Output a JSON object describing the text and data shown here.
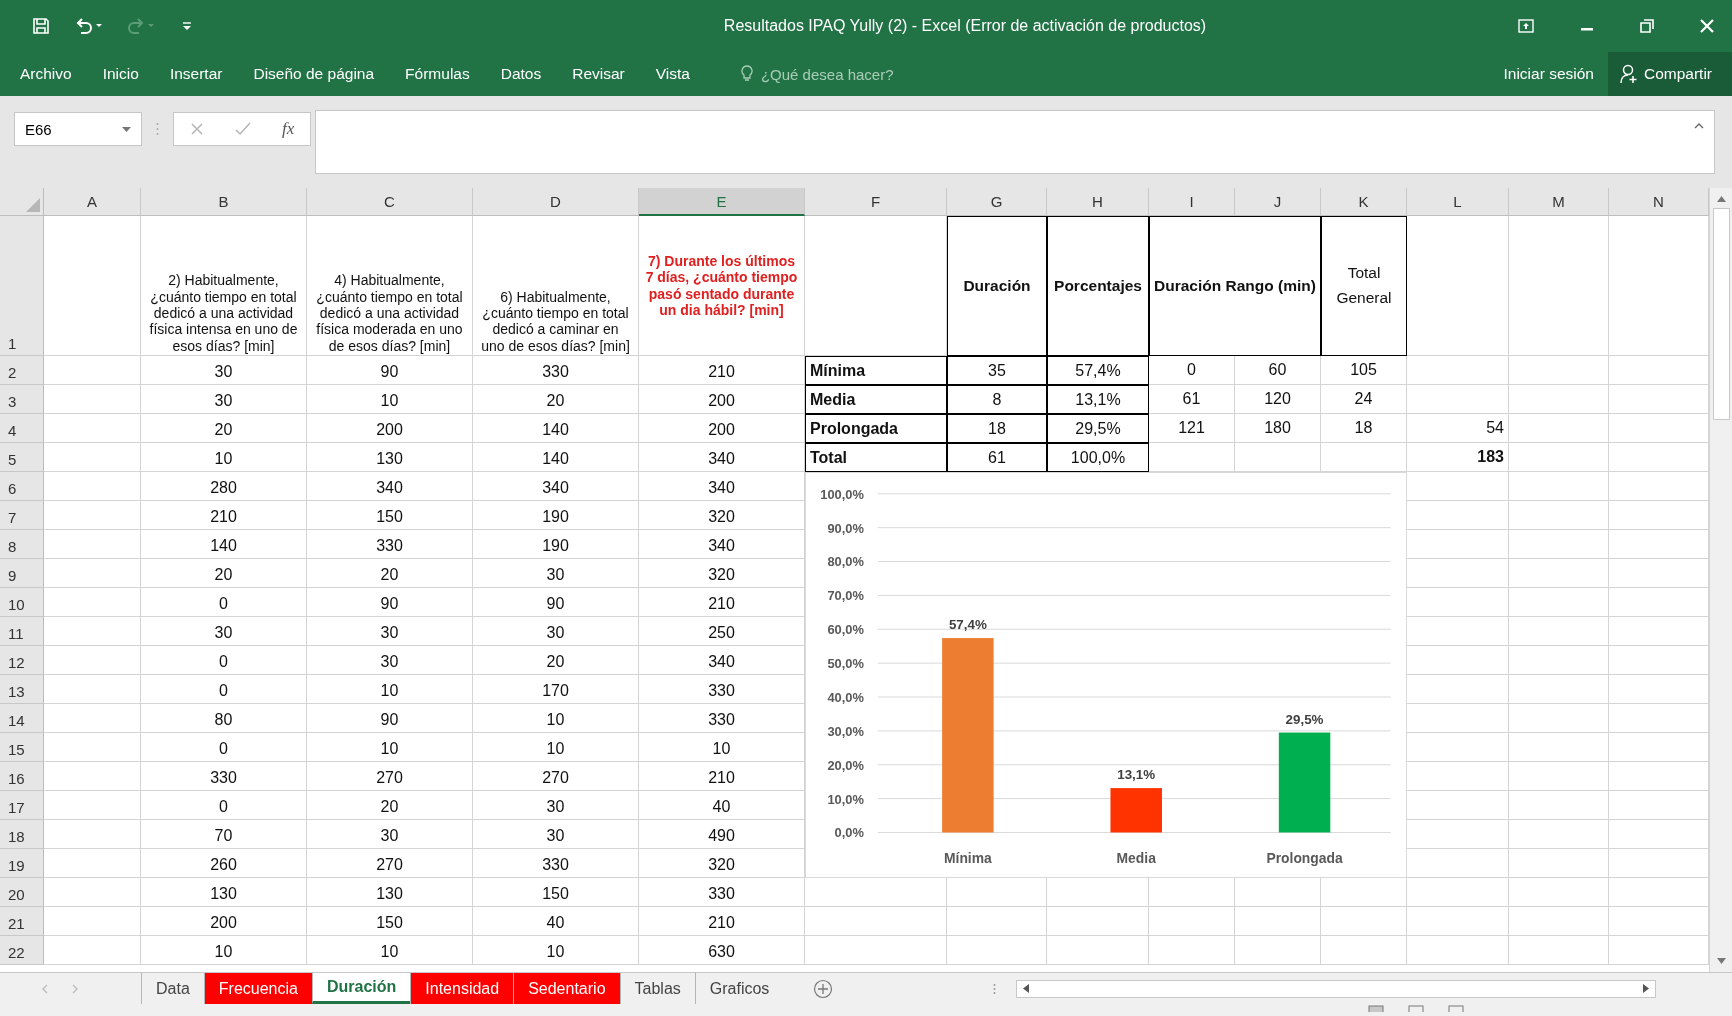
{
  "window": {
    "title": "Resultados IPAQ Yully (2) - Excel (Error de activación de productos)"
  },
  "ribbon_tabs": [
    "Archivo",
    "Inicio",
    "Insertar",
    "Diseño de página",
    "Fórmulas",
    "Datos",
    "Revisar",
    "Vista"
  ],
  "tell_me": {
    "placeholder": "¿Qué desea hacer?"
  },
  "sign_in": "Iniciar sesión",
  "share": "Compartir",
  "formula_bar": {
    "name_box": "E66",
    "insert_function": "fx"
  },
  "column_headers": [
    {
      "label": "A",
      "selected": false
    },
    {
      "label": "B",
      "selected": false
    },
    {
      "label": "C",
      "selected": false
    },
    {
      "label": "D",
      "selected": false
    },
    {
      "label": "E",
      "selected": true
    },
    {
      "label": "F",
      "selected": false
    },
    {
      "label": "G",
      "selected": false
    },
    {
      "label": "H",
      "selected": false
    },
    {
      "label": "I",
      "selected": false
    },
    {
      "label": "J",
      "selected": false
    },
    {
      "label": "K",
      "selected": false
    },
    {
      "label": "L",
      "selected": false
    },
    {
      "label": "M",
      "selected": false
    },
    {
      "label": "N",
      "selected": false
    }
  ],
  "row_numbers": [
    "1",
    "2",
    "3",
    "4",
    "5",
    "6",
    "7",
    "8",
    "9",
    "10",
    "11",
    "12",
    "13",
    "14",
    "15",
    "16",
    "17",
    "18",
    "19",
    "20",
    "21",
    "22"
  ],
  "survey_table": {
    "headers": [
      {
        "text": "2) Habitualmente, ¿cuánto tiempo en total dedicó a una actividad física intensa en uno de esos días? [min]",
        "emphasized": false
      },
      {
        "text": "4) Habitualmente, ¿cuánto tiempo en total dedicó a una actividad física moderada en uno de esos días? [min]",
        "emphasized": false
      },
      {
        "text": "6) Habitualmente, ¿cuánto tiempo en total dedicó a caminar en uno de esos días? [min]",
        "emphasized": false
      },
      {
        "text": "7) Durante los últimos 7 días, ¿cuánto tiempo pasó sentado durante un dia hábil? [min]",
        "emphasized": true
      }
    ],
    "rows": [
      [
        "30",
        "90",
        "330",
        "210"
      ],
      [
        "30",
        "10",
        "20",
        "200"
      ],
      [
        "20",
        "200",
        "140",
        "200"
      ],
      [
        "10",
        "130",
        "140",
        "340"
      ],
      [
        "280",
        "340",
        "340",
        "340"
      ],
      [
        "210",
        "150",
        "190",
        "320"
      ],
      [
        "140",
        "330",
        "190",
        "340"
      ],
      [
        "20",
        "20",
        "30",
        "320"
      ],
      [
        "0",
        "90",
        "90",
        "210"
      ],
      [
        "30",
        "30",
        "30",
        "250"
      ],
      [
        "0",
        "30",
        "20",
        "340"
      ],
      [
        "0",
        "10",
        "170",
        "330"
      ],
      [
        "80",
        "90",
        "10",
        "330"
      ],
      [
        "0",
        "10",
        "10",
        "10"
      ],
      [
        "330",
        "270",
        "270",
        "210"
      ],
      [
        "0",
        "20",
        "30",
        "40"
      ],
      [
        "70",
        "30",
        "30",
        "490"
      ],
      [
        "260",
        "270",
        "330",
        "320"
      ],
      [
        "130",
        "130",
        "150",
        "330"
      ],
      [
        "200",
        "150",
        "40",
        "210"
      ],
      [
        "10",
        "10",
        "10",
        "630"
      ]
    ]
  },
  "summary_table": {
    "headers": [
      "Duración",
      "Porcentajes",
      "Duración Rango (min)",
      "Total General"
    ],
    "rows": [
      {
        "kind": "category",
        "label": "Mínima",
        "duracion": "35",
        "porcentaje": "57,4%",
        "rango_desde": "0",
        "rango_hasta": "60",
        "total_general": "105"
      },
      {
        "kind": "category",
        "label": "Media",
        "duracion": "8",
        "porcentaje": "13,1%",
        "rango_desde": "61",
        "rango_hasta": "120",
        "total_general": "24"
      },
      {
        "kind": "category",
        "label": "Prolongada",
        "duracion": "18",
        "porcentaje": "29,5%",
        "rango_desde": "121",
        "rango_hasta": "180",
        "total_general": "18",
        "columna_l": "54"
      },
      {
        "kind": "total",
        "label": "Total",
        "duracion": "61",
        "porcentaje": "100,0%",
        "columna_l": "183"
      }
    ]
  },
  "chart_data": {
    "type": "bar",
    "categories": [
      "Mínima",
      "Media",
      "Prolongada"
    ],
    "stacked": true,
    "grid": true,
    "series": [
      {
        "color": "#ed7d31",
        "values": [
          0.574,
          null,
          null
        ]
      },
      {
        "color": "#ff3300",
        "values": [
          null,
          0.131,
          null
        ]
      },
      {
        "color": "#00b050",
        "values": [
          null,
          null,
          0.295
        ]
      }
    ],
    "ylim": [
      0,
      1
    ],
    "yticks": [
      {
        "value": 0,
        "label": "0,0%"
      },
      {
        "value": 0.1,
        "label": "10,0%"
      },
      {
        "value": 0.2,
        "label": "20,0%"
      },
      {
        "value": 0.3,
        "label": "30,0%"
      },
      {
        "value": 0.4,
        "label": "40,0%"
      },
      {
        "value": 0.5,
        "label": "50,0%"
      },
      {
        "value": 0.6,
        "label": "60,0%"
      },
      {
        "value": 0.7,
        "label": "70,0%"
      },
      {
        "value": 0.8,
        "label": "80,0%"
      },
      {
        "value": 0.9,
        "label": "90,0%"
      },
      {
        "value": 1,
        "label": "100,0%"
      }
    ],
    "value_labels": [
      "57,4%",
      "13,1%",
      "29,5%"
    ]
  },
  "sheet_tabs": [
    {
      "label": "Data",
      "selected": false
    },
    {
      "label": "Frecuencia",
      "selected": false,
      "color": "#ff0000"
    },
    {
      "label": "Duración",
      "selected": true
    },
    {
      "label": "Intensidad",
      "selected": false,
      "color": "#ff0000"
    },
    {
      "label": "Sedentario",
      "selected": false,
      "color": "#ff0000"
    },
    {
      "label": "Tablas",
      "selected": false
    },
    {
      "label": "Graficos",
      "selected": false
    }
  ]
}
